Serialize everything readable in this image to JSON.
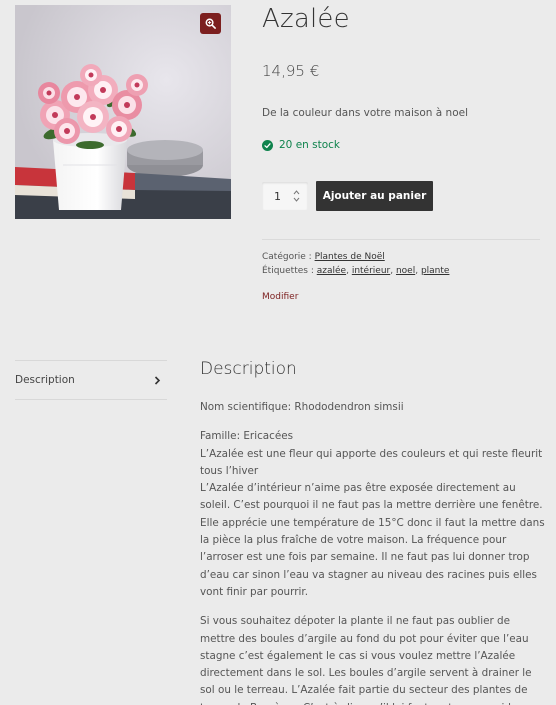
{
  "product": {
    "title": "Azalée",
    "price": "14,95 €",
    "short_description": "De la couleur dans votre maison à noel",
    "stock": "20 en stock",
    "quantity": "1",
    "add_to_cart_label": "Ajouter au panier",
    "image_alt": "Azalée en pot blanc"
  },
  "meta": {
    "category_label": "Catégorie :",
    "category": "Plantes de Noël",
    "tags_label": "Étiquettes :",
    "tags": [
      "azalée",
      "intérieur",
      "noel",
      "plante"
    ],
    "edit_label": "Modifier"
  },
  "tabs": {
    "description_label": "Description"
  },
  "description": {
    "heading": "Description",
    "paragraphs": [
      [
        "Nom scientifique: Rhododendron simsii"
      ],
      [
        "Famille: Ericacées",
        "L’Azalée est une fleur qui apporte des couleurs et qui reste fleurit tous l’hiver",
        "L’Azalée d’intérieur n’aime pas être exposée directement au soleil. C’est pourquoi il ne faut pas la mettre derrière une fenêtre. Elle apprécie une température de 15°C donc il faut la mettre dans la pièce la plus fraîche de votre maison. La fréquence pour l’arroser est une fois par semaine. Il ne faut pas lui donner trop d’eau car sinon l’eau va stagner au niveau des racines puis elles vont finir par pourrir."
      ],
      [
        "Si vous souhaitez dépoter la plante il ne faut pas oublier de mettre des boules d’argile au fond du pot pour éviter que l’eau stagne c’est également le cas si vous voulez mettre l’Azalée directement dans le sol. Les boules d’argile servent à drainer le sol ou le terreau. L’Azalée fait partie du secteur des plantes de terres de Bruyères. C’est-à-dire qu’il lui faut un terreau acide."
      ]
    ]
  },
  "colors": {
    "accent": "#7c1f1f",
    "stock_green": "#0f834d",
    "button_dark": "#333333",
    "background": "#ebebeb"
  },
  "icons": {
    "zoom": "zoom-in-icon",
    "stock": "check-circle-icon",
    "tab_arrow": "chevron-right-icon",
    "qty_spinner": "spinner-arrows-icon"
  }
}
